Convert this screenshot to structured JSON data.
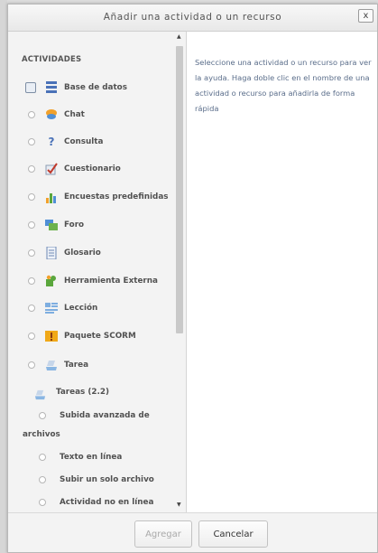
{
  "dialog": {
    "title": "Añadir una actividad o un recurso",
    "close_label": "x"
  },
  "activities": {
    "heading": "ACTIVIDADES",
    "items": [
      {
        "label": "Base de datos",
        "icon": "database-icon",
        "selected": true
      },
      {
        "label": "Chat",
        "icon": "chat-icon"
      },
      {
        "label": "Consulta",
        "icon": "question-icon"
      },
      {
        "label": "Cuestionario",
        "icon": "quiz-check-icon"
      },
      {
        "label": "Encuestas predefinidas",
        "icon": "bar-chart-icon"
      },
      {
        "label": "Foro",
        "icon": "forum-icon"
      },
      {
        "label": "Glosario",
        "icon": "glossary-icon"
      },
      {
        "label": "Herramienta Externa",
        "icon": "puzzle-icon"
      },
      {
        "label": "Lección",
        "icon": "lesson-icon"
      },
      {
        "label": "Paquete SCORM",
        "icon": "scorm-package-icon"
      },
      {
        "label": "Tarea",
        "icon": "assignment-icon"
      }
    ],
    "sub_group": {
      "label": "Tareas (2.2)",
      "icon": "assignment-icon",
      "items": [
        {
          "label_line1": "Subida avanzada de",
          "label_line2": "archivos"
        },
        {
          "label": "Texto en línea"
        },
        {
          "label": "Subir un solo archivo"
        },
        {
          "label": "Actividad no en línea"
        }
      ]
    }
  },
  "help_text": "Seleccione una actividad o un recurso para ver la ayuda. Haga doble clic en el nombre de una actividad o recurso para añadirla de forma rápida",
  "footer": {
    "add_label": "Agregar",
    "cancel_label": "Cancelar"
  },
  "colors": {
    "help_text": "#5a6d8a",
    "panel_bg": "#f3f3f3"
  }
}
